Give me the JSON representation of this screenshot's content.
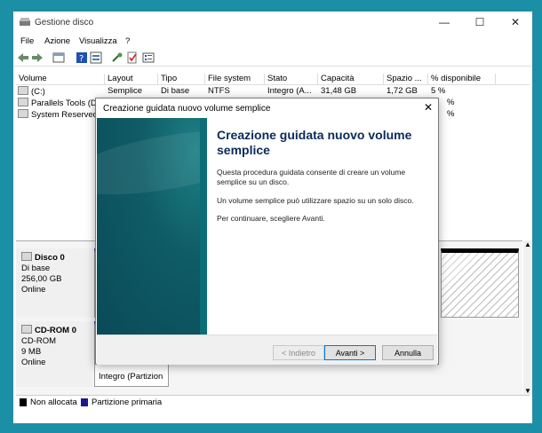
{
  "window": {
    "title": "Gestione disco"
  },
  "menu": [
    "File",
    "Azione",
    "Visualizza",
    "?"
  ],
  "volumes": {
    "columns": [
      "Volume",
      "Layout",
      "Tipo",
      "File system",
      "Stato",
      "Capacità",
      "Spazio ...",
      "% disponibile"
    ],
    "rows": [
      [
        "(C:)",
        "Semplice",
        "Di base",
        "NTFS",
        "Integro (A...",
        "31,48 GB",
        "1,72 GB",
        "5 %"
      ],
      [
        "Parallels Tools (D:)",
        "",
        "",
        "",
        "",
        "",
        "",
        "%"
      ],
      [
        "System Reserved",
        "",
        "",
        "",
        "",
        "",
        "",
        "%"
      ]
    ]
  },
  "disks": [
    {
      "name": "Disco 0",
      "type": "Di base",
      "size": "256,00 GB",
      "status": "Online"
    },
    {
      "name": "CD-ROM 0",
      "type": "CD-ROM",
      "size": "9 MB",
      "status": "Online",
      "partition_text": "Integro (Partizion"
    }
  ],
  "legend": [
    {
      "label": "Non allocata",
      "color": "#000000"
    },
    {
      "label": "Partizione primaria",
      "color": "#1a1a8c"
    }
  ],
  "dialog": {
    "title": "Creazione guidata nuovo volume semplice",
    "heading": "Creazione guidata nuovo volume semplice",
    "p1": "Questa procedura guidata consente di creare un volume semplice su un disco.",
    "p2": "Un volume semplice può utilizzare spazio su un solo disco.",
    "p3": "Per continuare, scegliere Avanti.",
    "back": "< Indietro",
    "next": "Avanti >",
    "cancel": "Annulla"
  }
}
